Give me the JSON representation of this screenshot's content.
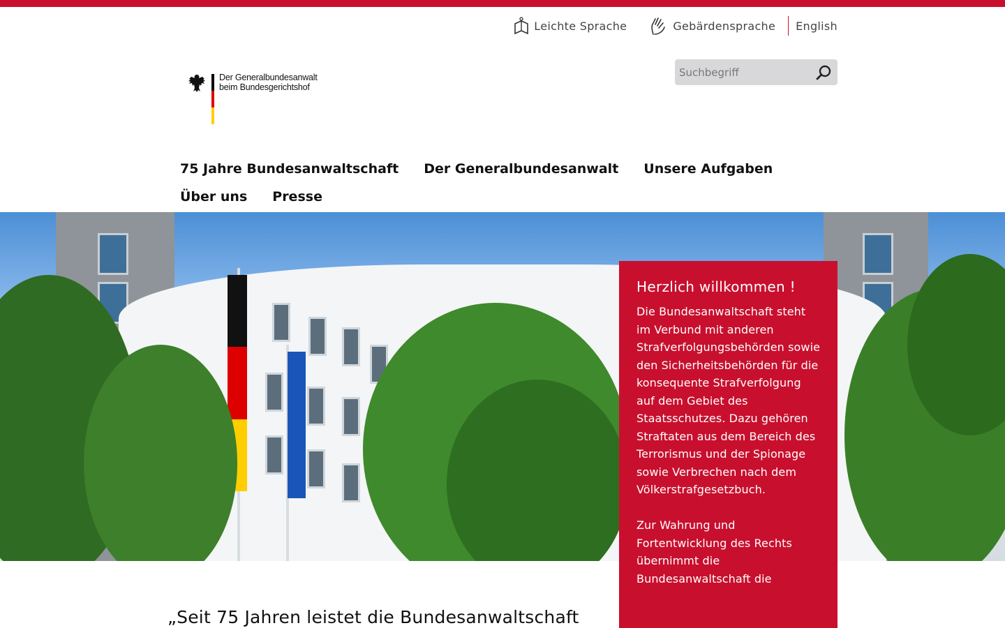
{
  "service_nav": {
    "easy_language": "Leichte Sprache",
    "sign_language": "Gebärdensprache",
    "english": "English"
  },
  "logo": {
    "line1": "Der Generalbundesanwalt",
    "line2": "beim Bundesgerichtshof"
  },
  "search": {
    "placeholder": "Suchbegriff"
  },
  "main_nav": [
    "75 Jahre Bundesanwaltschaft",
    "Der Generalbundesanwalt",
    "Unsere Aufgaben",
    "Über uns",
    "Presse"
  ],
  "welcome": {
    "title": "Herzlich willkommen !",
    "paragraph1": "Die Bundesanwaltschaft steht im Verbund mit anderen Strafverfolgungsbehörden sowie den Sicherheitsbehörden für die konsequente Strafverfolgung auf dem Gebiet des Staatsschutzes. Dazu gehören Straftaten aus dem Bereich des Terrorismus und der Spionage sowie Verbrechen nach dem Völkerstrafgesetzbuch.",
    "paragraph2": "Zur Wahrung und Fortentwicklung des Rechts übernimmt die Bundesanwaltschaft die"
  },
  "quote": "„Seit 75 Jahren leistet die Bundesanwaltschaft",
  "colors": {
    "accent_red": "#c8102e",
    "search_bg": "#d8d8da"
  }
}
